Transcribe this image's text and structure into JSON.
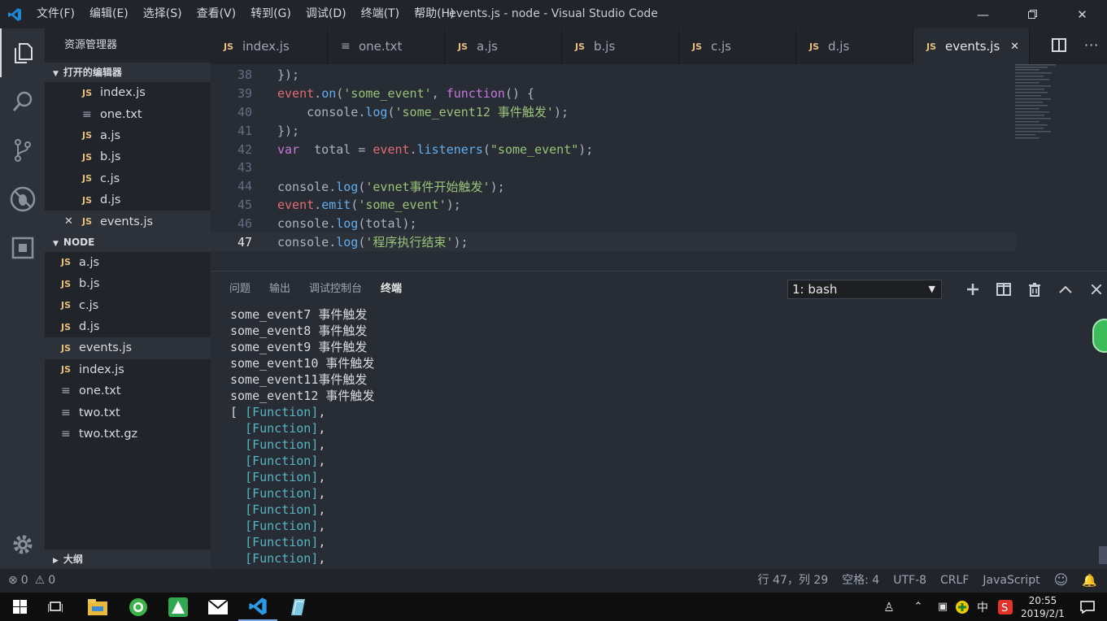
{
  "title": "events.js - node - Visual Studio Code",
  "menu": [
    "文件(F)",
    "编辑(E)",
    "选择(S)",
    "查看(V)",
    "转到(G)",
    "调试(D)",
    "终端(T)",
    "帮助(H)"
  ],
  "sidebar": {
    "title": "资源管理器",
    "open_editors_label": "打开的编辑器",
    "open_editors": [
      {
        "icon": "js-icon",
        "name": "index.js"
      },
      {
        "icon": "text-file-icon",
        "name": "one.txt"
      },
      {
        "icon": "js-icon",
        "name": "a.js"
      },
      {
        "icon": "js-icon",
        "name": "b.js"
      },
      {
        "icon": "js-icon",
        "name": "c.js"
      },
      {
        "icon": "js-icon",
        "name": "d.js"
      },
      {
        "icon": "js-icon",
        "name": "events.js"
      }
    ],
    "folder_label": "NODE",
    "files": [
      {
        "icon": "js-icon",
        "name": "a.js"
      },
      {
        "icon": "js-icon",
        "name": "b.js"
      },
      {
        "icon": "js-icon",
        "name": "c.js"
      },
      {
        "icon": "js-icon",
        "name": "d.js"
      },
      {
        "icon": "js-icon",
        "name": "events.js"
      },
      {
        "icon": "js-icon",
        "name": "index.js"
      },
      {
        "icon": "text-file-icon",
        "name": "one.txt"
      },
      {
        "icon": "text-file-icon",
        "name": "two.txt"
      },
      {
        "icon": "text-file-icon",
        "name": "two.txt.gz"
      }
    ],
    "outline_label": "大纲"
  },
  "tabs": [
    {
      "icon": "js-icon",
      "label": "index.js"
    },
    {
      "icon": "text-file-icon",
      "label": "one.txt"
    },
    {
      "icon": "js-icon",
      "label": "a.js"
    },
    {
      "icon": "js-icon",
      "label": "b.js"
    },
    {
      "icon": "js-icon",
      "label": "c.js"
    },
    {
      "icon": "js-icon",
      "label": "d.js"
    },
    {
      "icon": "js-icon",
      "label": "events.js",
      "active": true
    }
  ],
  "editor": {
    "lines": [
      {
        "n": "38",
        "code": "});"
      },
      {
        "n": "39",
        "code": "event.on('some_event', function() {"
      },
      {
        "n": "40",
        "code": "    console.log('some_event12 事件触发');"
      },
      {
        "n": "41",
        "code": "});"
      },
      {
        "n": "42",
        "code": "var  total = event.listeners(\"some_event\");"
      },
      {
        "n": "43",
        "code": ""
      },
      {
        "n": "44",
        "code": "console.log('evnet事件开始触发');"
      },
      {
        "n": "45",
        "code": "event.emit('some_event');"
      },
      {
        "n": "46",
        "code": "console.log(total);"
      },
      {
        "n": "47",
        "code": "console.log('程序执行结束');"
      }
    ],
    "current_line": "47"
  },
  "panel": {
    "tabs": [
      "问题",
      "输出",
      "调试控制台",
      "终端"
    ],
    "active_tab": "终端",
    "terminal_select": "1: bash",
    "terminal_lines": [
      "some_event7 事件触发",
      "some_event8 事件触发",
      "some_event9 事件触发",
      "some_event10 事件触发",
      "some_event11事件触发",
      "some_event12 事件触发",
      "[ [Function],",
      "  [Function],",
      "  [Function],",
      "  [Function],",
      "  [Function],",
      "  [Function],",
      "  [Function],",
      "  [Function],",
      "  [Function],",
      "  [Function],"
    ]
  },
  "status": {
    "errors": "0",
    "warnings": "0",
    "position": "行 47，列 29",
    "indent": "空格: 4",
    "encoding": "UTF-8",
    "eol": "CRLF",
    "language": "JavaScript"
  },
  "taskbar": {
    "ime": "中",
    "time": "20:55",
    "date": "2019/2/1"
  },
  "colors": {
    "accent": "#2c313a",
    "js": "#e5c07b",
    "string": "#98c379",
    "keyword": "#c678dd",
    "function": "#61afef"
  }
}
